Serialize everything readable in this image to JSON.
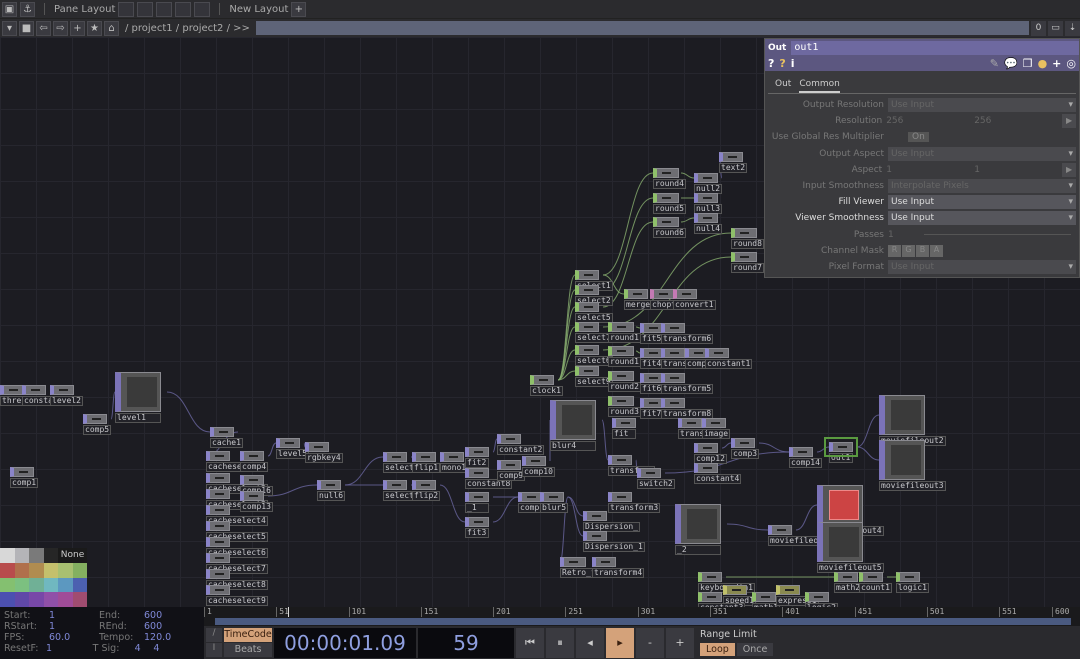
{
  "toolbar": {
    "pane_layout": "Pane Layout",
    "new_layout": "New Layout",
    "add": "+"
  },
  "pathbar": {
    "path": "/ project1 / project2 / >>",
    "counter": "0"
  },
  "nodes": [
    "thresh",
    "constant",
    "level2",
    "comp5",
    "comp1",
    "level1",
    "cache1",
    "cacheselect",
    "comp4",
    "cacheselect2",
    "comp16",
    "cacheselect3",
    "comp13",
    "cacheselect4",
    "cacheselect5",
    "cacheselect6",
    "cacheselect7",
    "cacheselect8",
    "cacheselect9",
    "level5",
    "rgbkey4",
    "null6",
    "select3",
    "flip1",
    "mono1",
    "fit2",
    "constant2",
    "constant8",
    "comp9",
    "comp10",
    "select4",
    "flip2",
    "_1",
    "fit3",
    "comp11",
    "blur5",
    "blur4",
    "Dispersion_",
    "Dispersion_1",
    "Retro_filter",
    "transform4",
    "transform",
    "switch2",
    "transform3",
    "_2",
    "clock1",
    "select1",
    "select2",
    "select5",
    "select7",
    "select6",
    "select9",
    "round1",
    "round1",
    "round2",
    "round3",
    "fit5",
    "fit4",
    "fit6",
    "fit7",
    "transform6",
    "transform7",
    "transform5",
    "transform8",
    "comp2",
    "constant1",
    "merge",
    "chopto",
    "convert1",
    "round4",
    "round5",
    "round6",
    "null2",
    "null3",
    "null4",
    "text2",
    "round8",
    "round7",
    "fit",
    "transform2",
    "image",
    "comp12",
    "constant4",
    "comp3",
    "comp14",
    "out1",
    "moviefileout2",
    "moviefileout3",
    "moviefileout4",
    "moviefileout1",
    "moviefileout5",
    "keyboardin1",
    "speed1",
    "math1",
    "express1",
    "logic2",
    "constant3",
    "math2",
    "count1",
    "logic1"
  ],
  "palette": {
    "none_label": "None",
    "colors": [
      "#d8d8d8",
      "#b4b4b8",
      "#7a7a7a",
      "#262626",
      "#b84c4c",
      "#b0704c",
      "#b08c50",
      "#c4c06c",
      "#a8c070",
      "#84b060",
      "#84c070",
      "#7cc080",
      "#70b096",
      "#70b8c0",
      "#5c98c0",
      "#4c60b0",
      "#4c50b0",
      "#6048a8",
      "#7848a8",
      "#9050a8",
      "#a04c98",
      "#a04c70"
    ]
  },
  "params": {
    "op_type": "Out",
    "op_name": "out1",
    "tabs": [
      "Out",
      "Common"
    ],
    "active_tab": "Common",
    "rows": [
      {
        "label": "Output Resolution",
        "value": "Use Input",
        "enabled": false,
        "kind": "menu"
      },
      {
        "label": "Resolution",
        "values": [
          "256",
          "256"
        ],
        "enabled": false,
        "kind": "pair"
      },
      {
        "label": "Use Global Res Multiplier",
        "value": "On",
        "enabled": false,
        "kind": "toggle"
      },
      {
        "label": "Output Aspect",
        "value": "Use Input",
        "enabled": false,
        "kind": "menu"
      },
      {
        "label": "Aspect",
        "values": [
          "1",
          "1"
        ],
        "enabled": false,
        "kind": "pair"
      },
      {
        "label": "Input Smoothness",
        "value": "Interpolate Pixels",
        "enabled": false,
        "kind": "menu"
      },
      {
        "label": "Fill Viewer",
        "value": "Use Input",
        "enabled": true,
        "kind": "menu"
      },
      {
        "label": "Viewer Smoothness",
        "value": "Use Input",
        "enabled": true,
        "kind": "menu"
      },
      {
        "label": "Passes",
        "value": "1",
        "enabled": false,
        "kind": "slider"
      },
      {
        "label": "Channel Mask",
        "values": [
          "R",
          "G",
          "B",
          "A"
        ],
        "enabled": false,
        "kind": "mask"
      },
      {
        "label": "Pixel Format",
        "value": "Use Input",
        "enabled": false,
        "kind": "menu"
      }
    ]
  },
  "info": {
    "start_k": "Start:",
    "start": "1",
    "end_k": "End:",
    "end": "600",
    "rstart_k": "RStart:",
    "rstart": "1",
    "rend_k": "REnd:",
    "rend": "600",
    "fps_k": "FPS:",
    "fps": "60.0",
    "tempo_k": "Tempo:",
    "tempo": "120.0",
    "resetf_k": "ResetF:",
    "resetf": "1",
    "tsig_k": "T Sig:",
    "tsig1": "4",
    "tsig2": "4"
  },
  "ruler": [
    "1",
    "51",
    "101",
    "151",
    "201",
    "251",
    "301",
    "351",
    "401",
    "451",
    "501",
    "551",
    "600"
  ],
  "timeline": {
    "timecode_label": "TimeCode",
    "beats_label": "Beats",
    "timecode": "00:00:01.09",
    "frame": "59",
    "range_limit": "Range Limit",
    "loop": "Loop",
    "once": "Once",
    "current_frame": 59,
    "total_frames": 600
  }
}
